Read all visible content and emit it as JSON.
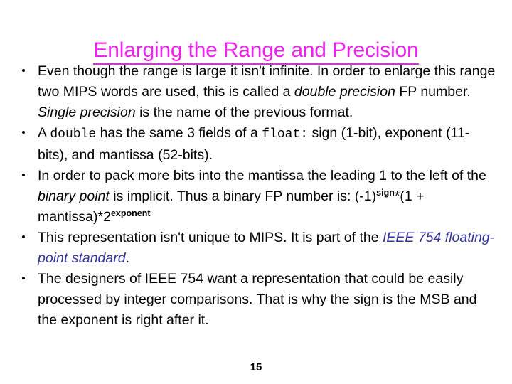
{
  "slide": {
    "title": "Enlarging the Range and Precision",
    "title_color": "#ee22ee",
    "background_color": "#ffffff",
    "page_number": "15",
    "bullets": [
      {
        "id": "bullet-range-not-infinite",
        "parts": [
          {
            "text": "Even though the range is large it isn't infinite. In order to enlarge this range two MIPS words are used, this is called a ",
            "style": "normal"
          },
          {
            "text": "double precision",
            "style": "italic"
          },
          {
            "text": " FP number. ",
            "style": "normal"
          },
          {
            "text": "Single precision",
            "style": "italic"
          },
          {
            "text": " is the name of the previous format.",
            "style": "normal"
          }
        ]
      },
      {
        "id": "bullet-double-fields",
        "parts": [
          {
            "text": "A ",
            "style": "normal"
          },
          {
            "text": "double",
            "style": "mono"
          },
          {
            "text": "  has the same 3 fields of a ",
            "style": "normal"
          },
          {
            "text": "float:",
            "style": "mono"
          },
          {
            "text": "  sign (1-bit), exponent (11-bits), and mantissa (52-bits).",
            "style": "normal"
          }
        ]
      },
      {
        "id": "bullet-implicit-leading-one",
        "parts": [
          {
            "text": "In order to pack more bits into the mantissa the leading 1 to the left of the ",
            "style": "normal"
          },
          {
            "text": "binary point",
            "style": "italic"
          },
          {
            "text": " is implicit. Thus a binary FP number is: (-1)",
            "style": "normal"
          },
          {
            "text": "sign",
            "style": "superscript"
          },
          {
            "text": "*(1 + mantissa)*2",
            "style": "normal"
          },
          {
            "text": "exponent",
            "style": "superscript"
          }
        ]
      },
      {
        "id": "bullet-ieee-754",
        "parts": [
          {
            "text": "This representation isn't unique to MIPS. It is part of the ",
            "style": "normal"
          },
          {
            "text": "IEEE 754 floating-point standard",
            "style": "blue-italic"
          },
          {
            "text": ".",
            "style": "normal"
          }
        ]
      },
      {
        "id": "bullet-integer-comparisons",
        "parts": [
          {
            "text": "The designers of IEEE 754 want a representation that could be easily processed by integer comparisons.  That is why the sign is the MSB and the exponent is right after it.",
            "style": "normal"
          }
        ]
      }
    ]
  }
}
